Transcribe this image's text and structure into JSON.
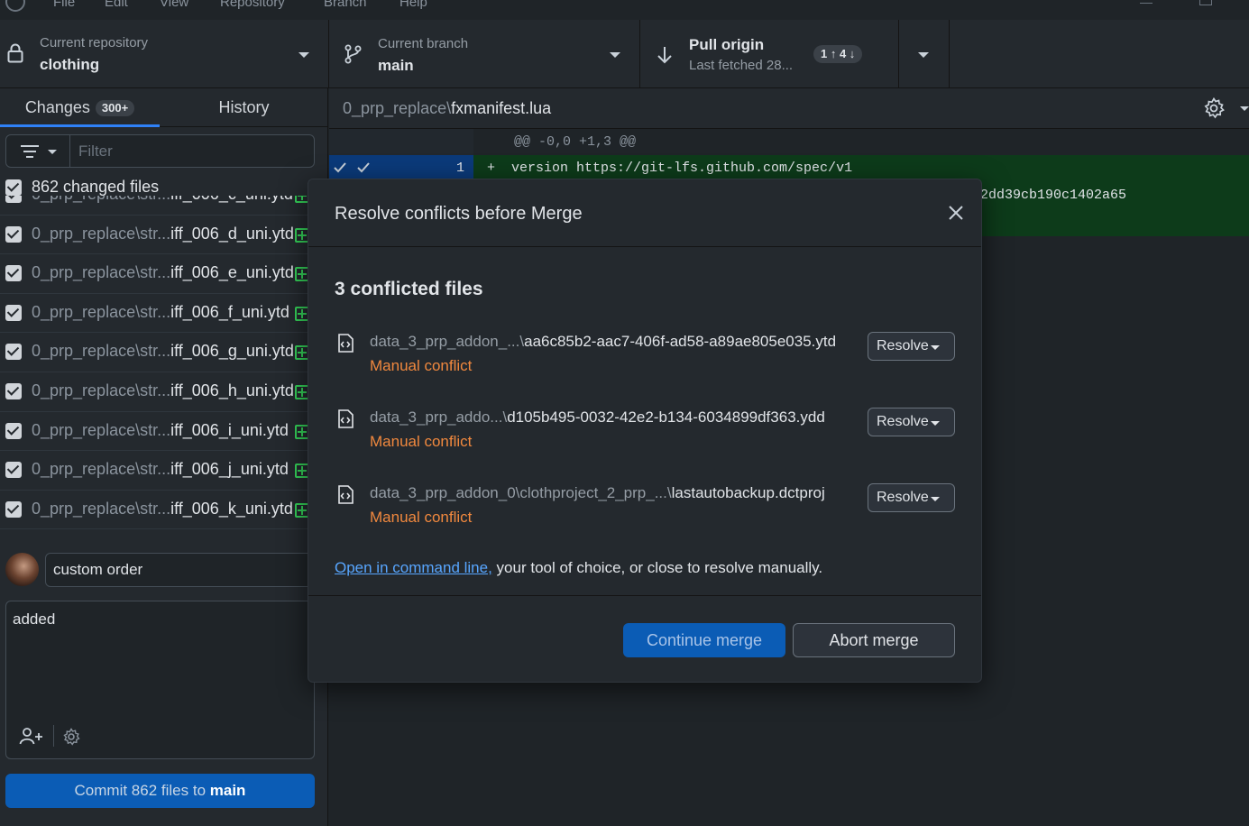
{
  "menubar": {
    "items": [
      "File",
      "Edit",
      "View",
      "Repository",
      "Branch",
      "Help"
    ]
  },
  "toolbar": {
    "repo": {
      "label": "Current repository",
      "value": "clothing"
    },
    "branch": {
      "label": "Current branch",
      "value": "main"
    },
    "pull": {
      "label": "Pull origin",
      "sublabel": "Last fetched 28...",
      "badge": "1 ↑ 4 ↓"
    }
  },
  "sidebar": {
    "tabs": [
      {
        "label": "Changes",
        "badge": "300+"
      },
      {
        "label": "History"
      }
    ],
    "filter_placeholder": "Filter",
    "changed_files_label": "862 changed files",
    "files": [
      {
        "prefix": "0_prp_replace\\str...",
        "name": "iff_006_c_uni.ytd"
      },
      {
        "prefix": "0_prp_replace\\str...",
        "name": "iff_006_d_uni.ytd"
      },
      {
        "prefix": "0_prp_replace\\str...",
        "name": "iff_006_e_uni.ytd"
      },
      {
        "prefix": "0_prp_replace\\str...",
        "name": "iff_006_f_uni.ytd"
      },
      {
        "prefix": "0_prp_replace\\str...",
        "name": "iff_006_g_uni.ytd"
      },
      {
        "prefix": "0_prp_replace\\str...",
        "name": "iff_006_h_uni.ytd"
      },
      {
        "prefix": "0_prp_replace\\str...",
        "name": "iff_006_i_uni.ytd"
      },
      {
        "prefix": "0_prp_replace\\str...",
        "name": "iff_006_j_uni.ytd"
      },
      {
        "prefix": "0_prp_replace\\str...",
        "name": "iff_006_k_uni.ytd"
      }
    ],
    "summary": "custom order",
    "description": "added",
    "commit": {
      "prefix": "Commit 862 files to ",
      "branch": "main"
    }
  },
  "diff": {
    "path_prefix": "0_prp_replace\\",
    "path_file": "fxmanifest.lua",
    "hunk": "@@ -0,0 +1,3 @@",
    "line1_num": "1",
    "line1_code": "+  version https://git-lfs.github.com/spec/v1",
    "line2_code": "2dd39cb190c1402a65"
  },
  "modal": {
    "title": "Resolve conflicts before Merge",
    "heading": "3 conflicted files",
    "conflicts": [
      {
        "prefix": "data_3_prp_addon_...\\",
        "name": "aa6c85b2-aac7-406f-ad58-a89ae805e035.ytd",
        "status": "Manual conflict",
        "button": "Resolve"
      },
      {
        "prefix": "data_3_prp_addo...\\",
        "name": "d105b495-0032-42e2-b134-6034899df363.ydd",
        "status": "Manual conflict",
        "button": "Resolve"
      },
      {
        "prefix": "data_3_prp_addon_0\\clothproject_2_prp_...\\",
        "name": "lastautobackup.dctproj",
        "status": "Manual conflict",
        "button": "Resolve"
      }
    ],
    "help_link": "Open in command line,",
    "help_rest": " your tool of choice, or close to resolve manually.",
    "continue_label": "Continue merge",
    "abort_label": "Abort merge"
  },
  "colors": {
    "accent": "#2f81f7",
    "primary_button": "#0b5cb5",
    "conflict": "#f0883e",
    "added": "#34d058"
  },
  "icons": [
    "github-logo-icon",
    "lock-icon",
    "branch-icon",
    "arrow-down-icon",
    "filter-icon",
    "add-coauthor-icon",
    "gear-icon",
    "close-icon",
    "file-code-icon",
    "check-icon"
  ]
}
